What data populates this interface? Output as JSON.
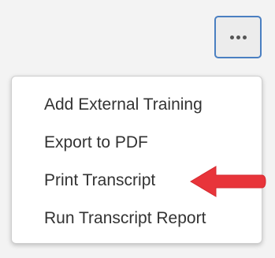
{
  "more_button": {
    "icon": "more-horizontal-icon"
  },
  "menu": {
    "items": [
      {
        "label": "Add External Training"
      },
      {
        "label": "Export to PDF"
      },
      {
        "label": "Print Transcript"
      },
      {
        "label": "Run Transcript Report"
      }
    ]
  },
  "annotation": {
    "arrow_color": "#e8343a",
    "arrow_icon": "left-pointing-arrow-icon"
  }
}
